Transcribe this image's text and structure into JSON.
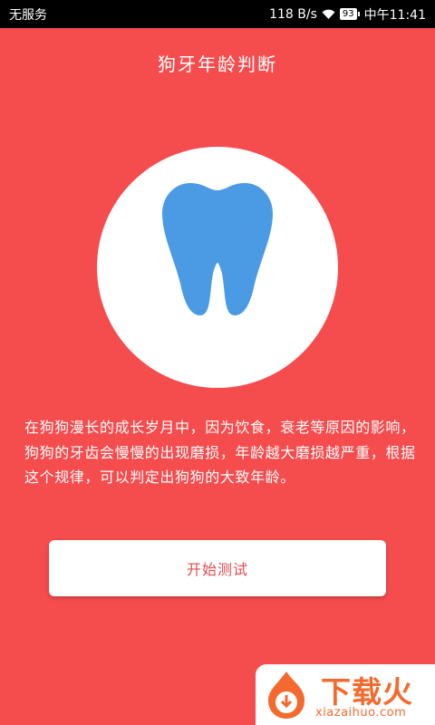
{
  "status_bar": {
    "carrier": "无服务",
    "network_speed": "118 B/s",
    "battery": "93",
    "time": "中午11:41"
  },
  "header": {
    "title": "狗牙年龄判断"
  },
  "main": {
    "description": "在狗狗漫长的成长岁月中，因为饮食，衰老等原因的影响，狗狗的牙齿会慢慢的出现磨损，年龄越大磨损越严重，根据这个规律，可以判定出狗狗的大致年龄。",
    "start_button": "开始测试"
  },
  "watermark": {
    "brand": "下载火",
    "url": "xiazaihuo.com"
  },
  "colors": {
    "background": "#f54c4e",
    "tooth": "#4a9be3",
    "button_text": "#e84a4c",
    "watermark_orange": "#f46a2e"
  },
  "icons": {
    "tooth": "tooth-icon",
    "wifi": "wifi-icon",
    "battery": "battery-icon",
    "watermark_logo": "fire-download-icon"
  }
}
